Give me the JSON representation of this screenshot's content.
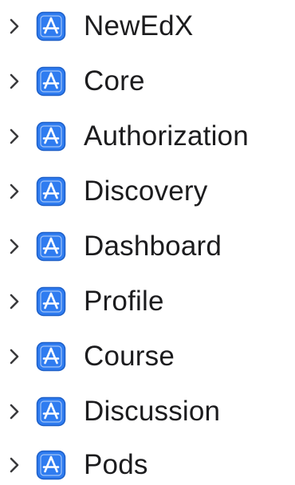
{
  "navigator": {
    "accent_color": "#2f7cf0",
    "accent_dark": "#1d5fc7",
    "text_color": "#1c1c1e",
    "chevron_color": "#3a3a3c",
    "disclosure_icon": "chevron-right-icon",
    "item_icon": "app-store-target-icon",
    "items": [
      {
        "label": "NewEdX",
        "expanded": false
      },
      {
        "label": "Core",
        "expanded": false
      },
      {
        "label": "Authorization",
        "expanded": false
      },
      {
        "label": "Discovery",
        "expanded": false
      },
      {
        "label": "Dashboard",
        "expanded": false
      },
      {
        "label": "Profile",
        "expanded": false
      },
      {
        "label": "Course",
        "expanded": false
      },
      {
        "label": "Discussion",
        "expanded": false
      },
      {
        "label": "Pods",
        "expanded": false
      }
    ]
  }
}
